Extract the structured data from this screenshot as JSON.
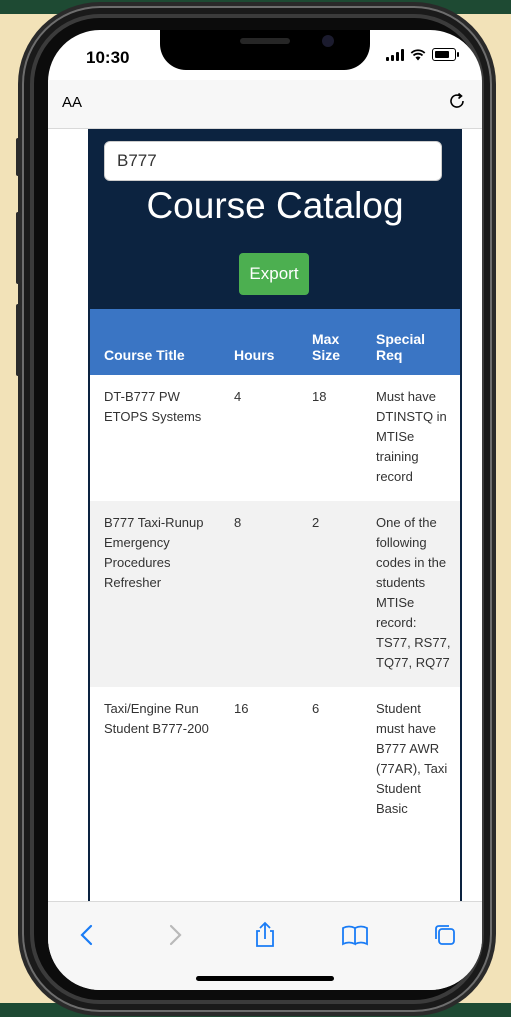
{
  "status": {
    "time": "10:30"
  },
  "browser": {
    "text_size_label": "AA"
  },
  "page": {
    "search_value": "B777",
    "title": "Course Catalog",
    "export_label": "Export"
  },
  "table": {
    "headers": [
      "Course Title",
      "Hours",
      "Max Size",
      "Special Req"
    ],
    "rows": [
      {
        "title": "DT-B777 PW ETOPS Systems",
        "hours": "4",
        "max_size": "18",
        "special_req": "Must have DTINSTQ in MTISe training record"
      },
      {
        "title": "B777 Taxi-Runup Emergency Procedures Refresher",
        "hours": "8",
        "max_size": "2",
        "special_req": "One of the following codes in the students MTISe record: TS77, RS77, TQ77, RQ77"
      },
      {
        "title": "Taxi/Engine Run Student B777-200",
        "hours": "16",
        "max_size": "6",
        "special_req": "Student must have B777 AWR (77AR), Taxi Student Basic"
      }
    ]
  },
  "colors": {
    "hero": "#0c2340",
    "header": "#3a75c4",
    "export": "#4caf50",
    "accent": "#1a7cf5"
  },
  "icons": [
    "back-icon",
    "forward-icon",
    "share-icon",
    "bookmarks-icon",
    "tabs-icon",
    "reload-icon"
  ]
}
